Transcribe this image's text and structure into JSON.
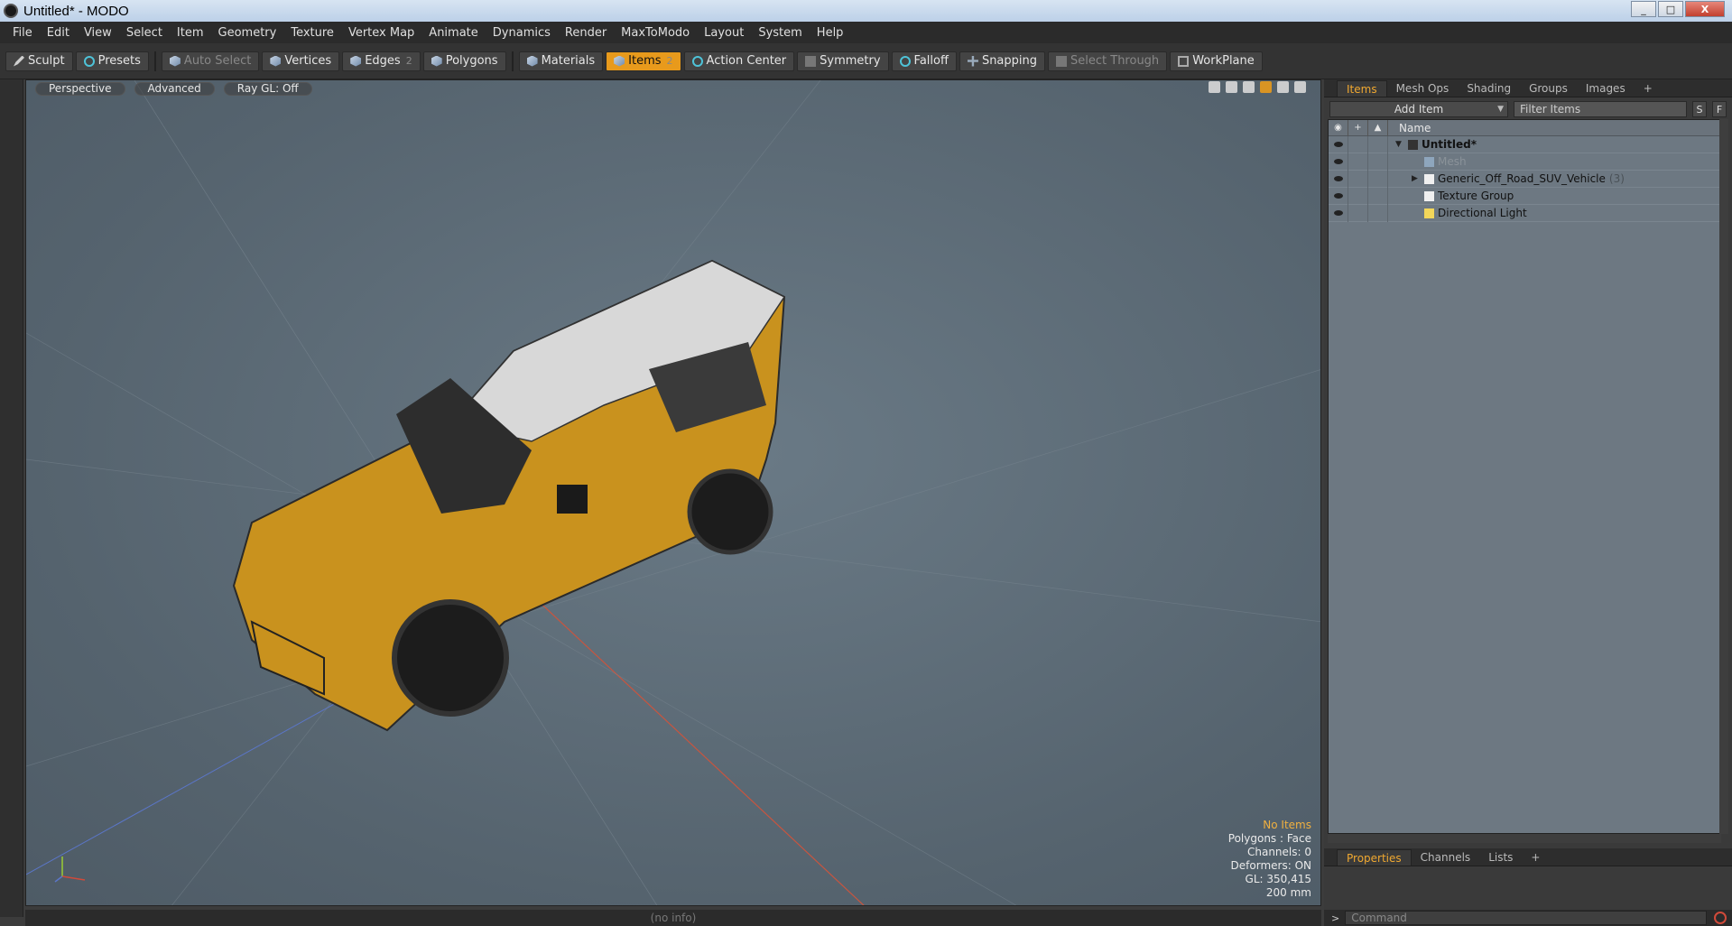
{
  "window": {
    "title": "Untitled* - MODO",
    "minimize": "_",
    "maximize": "□",
    "close": "X"
  },
  "menu": [
    "File",
    "Edit",
    "View",
    "Select",
    "Item",
    "Geometry",
    "Texture",
    "Vertex Map",
    "Animate",
    "Dynamics",
    "Render",
    "MaxToModo",
    "Layout",
    "System",
    "Help"
  ],
  "toolbar": {
    "sculpt": "Sculpt",
    "presets": "Presets",
    "auto_select": "Auto Select",
    "vertices": "Vertices",
    "edges": "Edges",
    "edges_count": "2",
    "polygons": "Polygons",
    "materials": "Materials",
    "items": "Items",
    "items_count": "2",
    "action_center": "Action Center",
    "symmetry": "Symmetry",
    "falloff": "Falloff",
    "snapping": "Snapping",
    "select_through": "Select Through",
    "workplane": "WorkPlane"
  },
  "viewport": {
    "view_mode": "Perspective",
    "shading": "Advanced",
    "raygl": "Ray GL: Off",
    "info": {
      "selection": "No Items",
      "polygons": "Polygons : Face",
      "channels": "Channels: 0",
      "deformers": "Deformers: ON",
      "gl": "GL: 350,415",
      "grid": "200 mm"
    }
  },
  "panel": {
    "tabs": [
      "Items",
      "Mesh Ops",
      "Shading",
      "Groups",
      "Images",
      "+"
    ],
    "add_item": "Add Item",
    "filter_placeholder": "Filter Items",
    "btn_s": "S",
    "btn_f": "F",
    "column_name": "Name",
    "tree": [
      {
        "label": "Untitled*",
        "bold": true
      },
      {
        "label": "Mesh",
        "muted": true
      },
      {
        "label": "Generic_Off_Road_SUV_Vehicle",
        "count": "(3)"
      },
      {
        "label": "Texture Group"
      },
      {
        "label": "Directional Light"
      }
    ]
  },
  "props": {
    "tabs": [
      "Properties",
      "Channels",
      "Lists",
      "+"
    ]
  },
  "command": {
    "prompt": ">",
    "placeholder": "Command"
  },
  "status": {
    "info": "(no info)"
  },
  "colors": {
    "accent": "#e89a1c",
    "vehicle_body": "#c9921e"
  }
}
